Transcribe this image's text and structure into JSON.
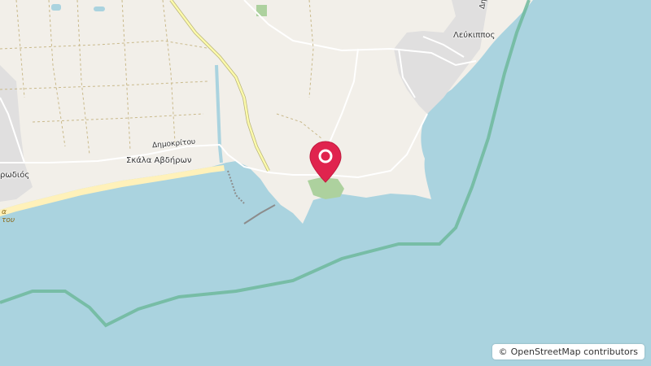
{
  "map": {
    "labels": {
      "town_leukippos": "Λεύκιππος",
      "street_dimokritou": "Δημοκρίτου",
      "town_skala_avdiron": "Σκάλα Αβδήρων",
      "partial_left_town": "ρωδιός",
      "partial_right_street": "Δημ",
      "beach_partial_1": "α",
      "beach_partial_2": "του"
    },
    "marker": {
      "icon": "location-pin-icon",
      "color": "#e0244e"
    }
  },
  "attribution": {
    "copyright_symbol": "©",
    "text": "OpenStreetMap contributors"
  },
  "colors": {
    "water": "#aad3df",
    "land": "#f2efe9",
    "residential": "#e0dfdf",
    "park": "#add19e",
    "beach": "#fff1ba",
    "primary_road": "#fcfaab",
    "boundary": "#6fb89c"
  }
}
